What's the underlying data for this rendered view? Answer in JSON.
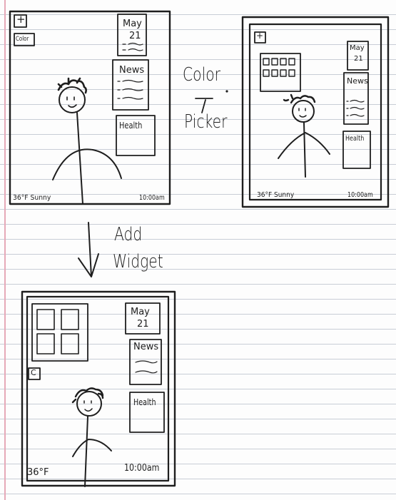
{
  "screen1": {
    "plus_button": "+",
    "color_button": "Color",
    "calendar_widget": {
      "month": "May",
      "day": "21"
    },
    "news_widget": "News",
    "health_widget": "Health",
    "weather": "36°F Sunny",
    "time": "10:00am"
  },
  "transition_color": {
    "line1": "Color",
    "line2": "Picker",
    "arrow": "→"
  },
  "screen2": {
    "plus_button": "+",
    "calendar_widget": {
      "month": "May",
      "day": "21"
    },
    "news_widget": "News",
    "health_widget": "Health",
    "weather": "36°F Sunny",
    "time": "10:00am"
  },
  "transition_widget": {
    "line1": "Add",
    "line2": "Widget"
  },
  "screen3": {
    "small_button": "C",
    "calendar_widget": {
      "month": "May",
      "day": "21"
    },
    "news_widget": "News",
    "health_widget": "Health",
    "weather": "36°F",
    "time": "10:00am"
  },
  "colors": {
    "ink": "#1e1e1e",
    "paper_rule": "#c8cdd6",
    "margin_rule": "#e6a9b8"
  }
}
